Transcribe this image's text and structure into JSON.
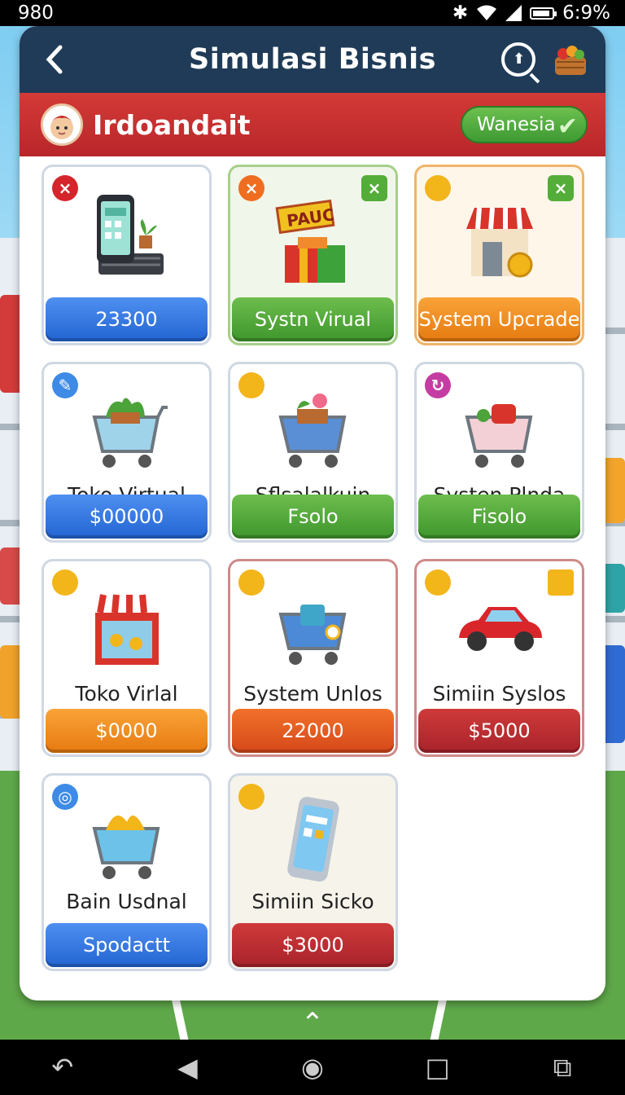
{
  "status": {
    "time": "980",
    "battery": "6:9%"
  },
  "header": {
    "back_icon": "back-chevron-icon",
    "title": "Simulasi Bisnis",
    "search_icon": "search-icon"
  },
  "user": {
    "name": "Irdoandait",
    "tag_label": "Wanesia"
  },
  "cards": [
    {
      "label": "",
      "button": "23300",
      "badge_left": "×",
      "badge_right": ""
    },
    {
      "label": "",
      "button": "Systn Virual",
      "badge_left": "×",
      "badge_right": "×",
      "sign": "PAUC"
    },
    {
      "label": "",
      "button": "System Upcrade",
      "badge_left": "",
      "badge_right": "×"
    },
    {
      "label": "Toko Virtual",
      "button": "$00000"
    },
    {
      "label": "Sflsalalkuin",
      "button": "Fsolo"
    },
    {
      "label": "Systen Plnda",
      "button": "Fisolo"
    },
    {
      "label": "Toko Virlal",
      "button": "$0000"
    },
    {
      "label": "System Unlos",
      "button": "22000"
    },
    {
      "label": "Simiin Syslos",
      "button": "$5000"
    },
    {
      "label": "Bain Usdnal",
      "button": "Spodactt"
    },
    {
      "label": "Simiin Sicko",
      "button": "$3000"
    }
  ],
  "colors": {
    "header": "#1f3b57",
    "user_bar": "#c3302f",
    "blue": "#2f74dc",
    "green": "#4ca63a",
    "orange": "#ef8a1c",
    "red": "#b7272d"
  }
}
